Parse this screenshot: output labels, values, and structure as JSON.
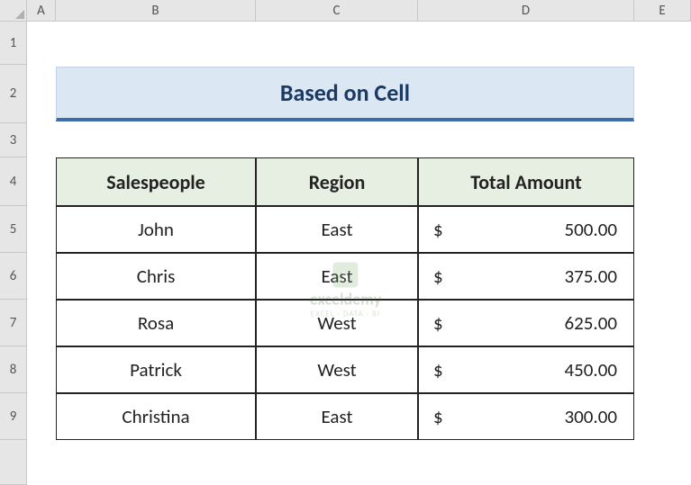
{
  "columns": [
    "A",
    "B",
    "C",
    "D",
    "E"
  ],
  "rows": [
    "1",
    "2",
    "3",
    "4",
    "5",
    "6",
    "7",
    "8",
    "9"
  ],
  "title": "Based on Cell",
  "headers": {
    "salespeople": "Salespeople",
    "region": "Region",
    "amount": "Total Amount"
  },
  "currency": "$",
  "data": [
    {
      "name": "John",
      "region": "East",
      "amount": "500.00"
    },
    {
      "name": "Chris",
      "region": "East",
      "amount": "375.00"
    },
    {
      "name": "Rosa",
      "region": "West",
      "amount": "625.00"
    },
    {
      "name": "Patrick",
      "region": "West",
      "amount": "450.00"
    },
    {
      "name": "Christina",
      "region": "East",
      "amount": "300.00"
    }
  ],
  "watermark": {
    "name": "exceldemy",
    "sub": "EXCEL · DATA · BI"
  },
  "chart_data": {
    "type": "table",
    "title": "Based on Cell",
    "columns": [
      "Salespeople",
      "Region",
      "Total Amount"
    ],
    "rows": [
      [
        "John",
        "East",
        500.0
      ],
      [
        "Chris",
        "East",
        375.0
      ],
      [
        "Rosa",
        "West",
        625.0
      ],
      [
        "Patrick",
        "West",
        450.0
      ],
      [
        "Christina",
        "East",
        300.0
      ]
    ]
  }
}
